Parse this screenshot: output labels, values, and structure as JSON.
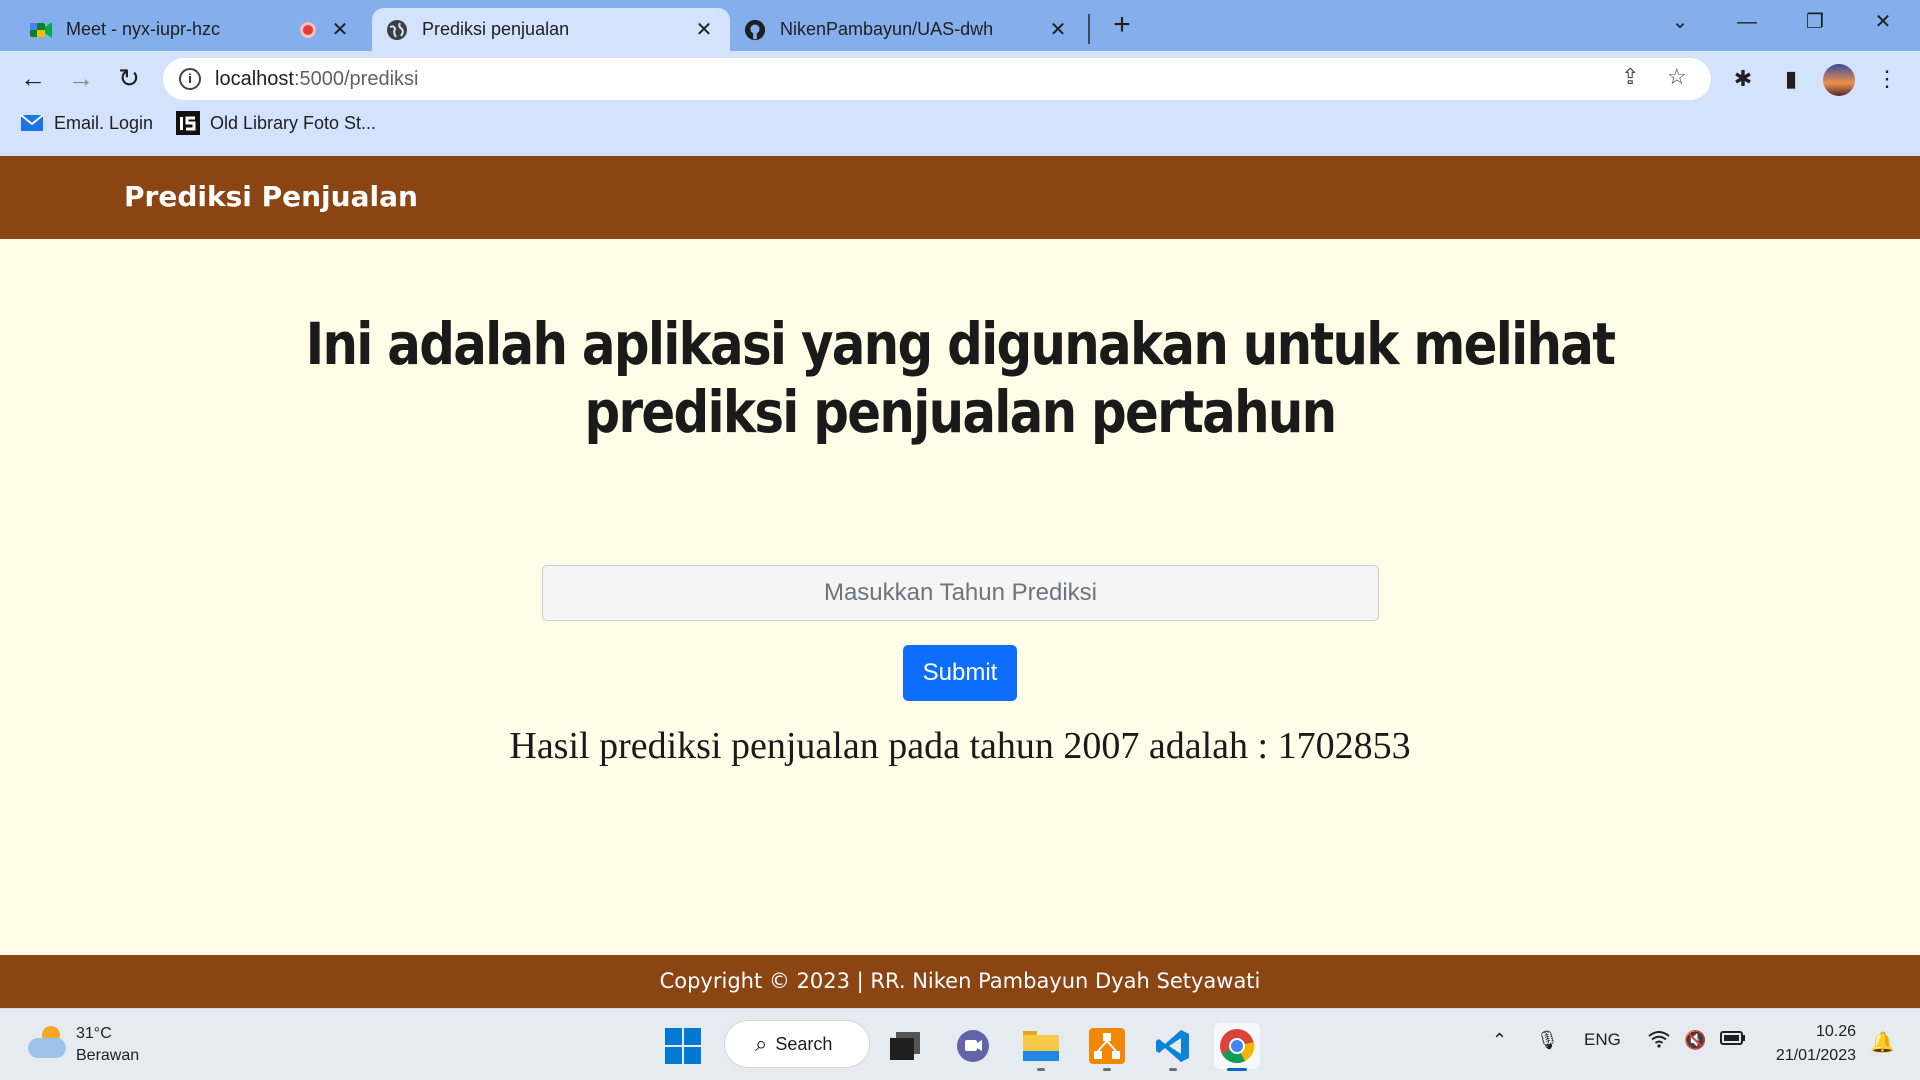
{
  "browser": {
    "tabs": [
      {
        "title": "Meet - nyx-iupr-hzc",
        "icon": "google-meet-icon"
      },
      {
        "title": "Prediksi penjualan",
        "icon": "globe-icon"
      },
      {
        "title": "NikenPambayun/UAS-dwh",
        "icon": "github-icon"
      }
    ],
    "url_host": "localhost",
    "url_path": ":5000/prediksi",
    "bookmarks": [
      {
        "label": "Email. Login",
        "icon": "mail-icon"
      },
      {
        "label": "Old Library Foto St...",
        "icon": "is-logo-icon"
      }
    ]
  },
  "page": {
    "brand": "Prediksi Penjualan",
    "headline": "Ini adalah aplikasi yang digunakan untuk melihat prediksi penjualan pertahun",
    "input_placeholder": "Masukkan Tahun Prediksi",
    "submit_label": "Submit",
    "result": "Hasil prediksi penjualan pada tahun 2007 adalah : 1702853",
    "footer": "Copyright © 2023 | RR. Niken Pambayun Dyah Setyawati",
    "colors": {
      "navbar": "#8b4513",
      "background": "#fffde8",
      "button": "#0d6efd"
    }
  },
  "taskbar": {
    "weather_temp": "31°C",
    "weather_desc": "Berawan",
    "search_label": "Search",
    "language": "ENG",
    "time": "10.26",
    "date": "21/01/2023"
  }
}
